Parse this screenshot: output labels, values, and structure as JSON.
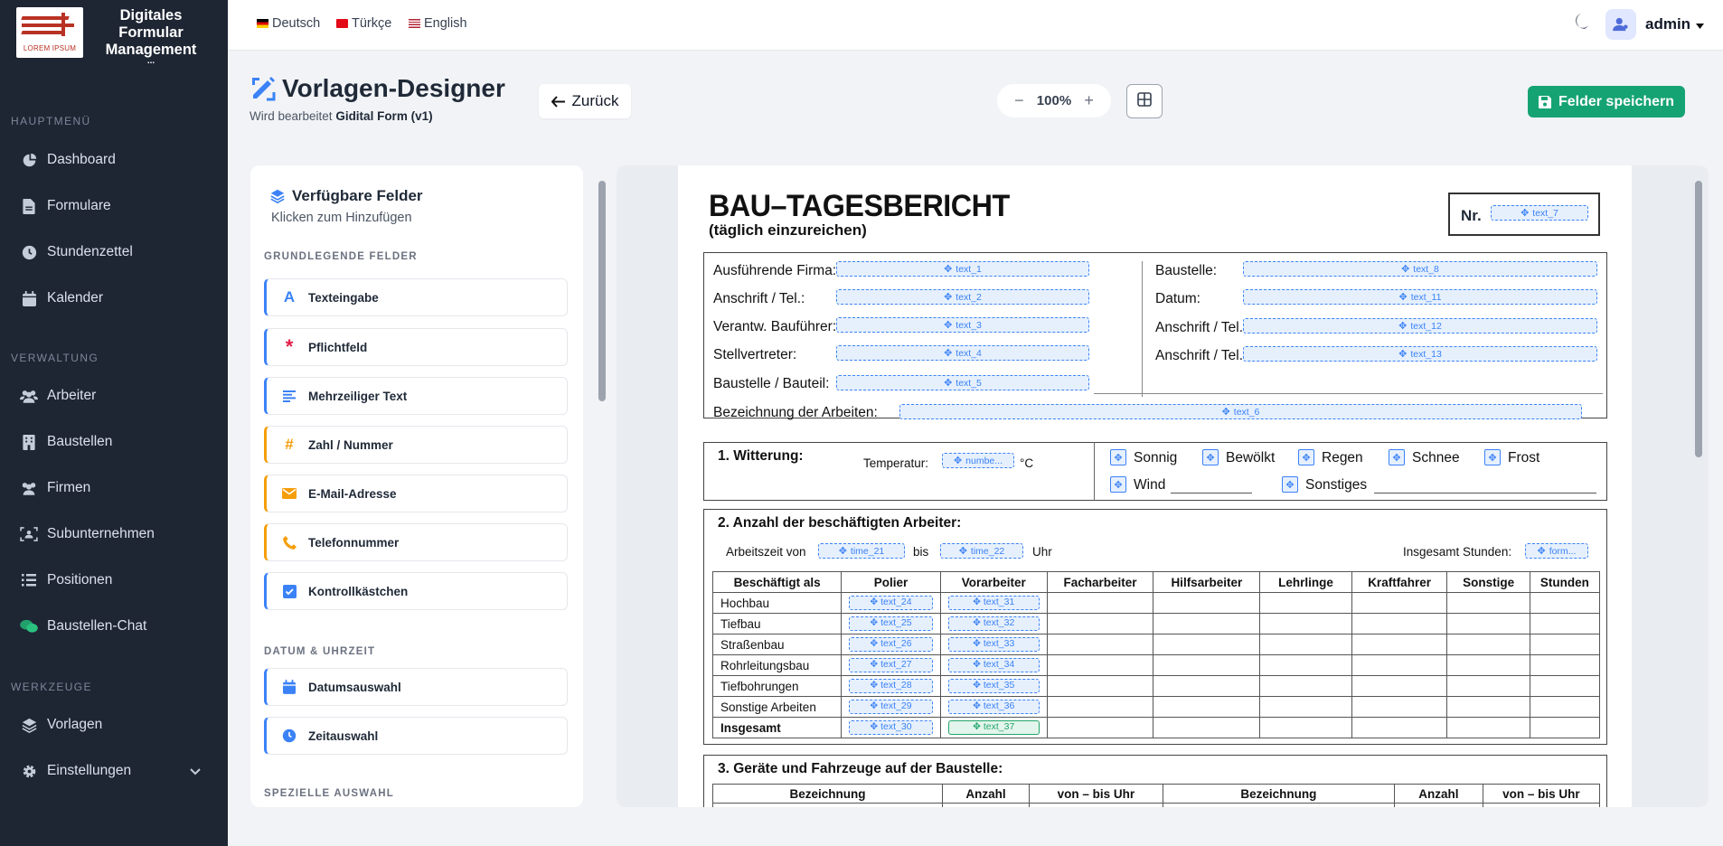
{
  "brand": {
    "name_lines": [
      "Digitales",
      "Formular",
      "Management"
    ],
    "name_ellipsis": "...",
    "logo_text": "LOREM IPSUM"
  },
  "sidebar": {
    "sections": [
      {
        "label": "HAUPTMENÜ",
        "items": [
          {
            "label": "Dashboard",
            "icon": "dashboard-icon"
          },
          {
            "label": "Formulare",
            "icon": "file-icon"
          },
          {
            "label": "Stundenzettel",
            "icon": "clock-icon"
          },
          {
            "label": "Kalender",
            "icon": "calendar-icon"
          }
        ]
      },
      {
        "label": "VERWALTUNG",
        "items": [
          {
            "label": "Arbeiter",
            "icon": "users-icon"
          },
          {
            "label": "Baustellen",
            "icon": "building-icon"
          },
          {
            "label": "Firmen",
            "icon": "users-icon"
          },
          {
            "label": "Subunternehmen",
            "icon": "user-group-icon"
          },
          {
            "label": "Positionen",
            "icon": "list-icon"
          },
          {
            "label": "Baustellen-Chat",
            "icon": "chat-icon"
          }
        ]
      },
      {
        "label": "WERKZEUGE",
        "items": [
          {
            "label": "Vorlagen",
            "icon": "layers-icon"
          },
          {
            "label": "Einstellungen",
            "icon": "gear-icon"
          }
        ]
      }
    ]
  },
  "topbar": {
    "languages": [
      {
        "label": "Deutsch",
        "flag": "de"
      },
      {
        "label": "Türkçe",
        "flag": "tr"
      },
      {
        "label": "English",
        "flag": "en"
      }
    ],
    "user": "admin"
  },
  "header": {
    "title": "Vorlagen-Designer",
    "subtitle_prefix": "Wird bearbeitet",
    "subtitle_form": "Gidital Form (v1)",
    "back_label": "Zurück",
    "zoom_label": "100%",
    "save_label": "Felder speichern"
  },
  "palette": {
    "title": "Verfügbare Felder",
    "subtitle": "Klicken zum Hinzufügen",
    "groups": [
      {
        "label": "GRUNDLEGENDE FELDER",
        "fields": [
          {
            "label": "Texteingabe",
            "icon": "text-icon"
          },
          {
            "label": "Pflichtfeld",
            "icon": "asterisk-icon"
          },
          {
            "label": "Mehrzeiliger Text",
            "icon": "paragraph-icon"
          },
          {
            "label": "Zahl / Nummer",
            "icon": "hash-icon"
          },
          {
            "label": "E-Mail-Adresse",
            "icon": "envelope-icon"
          },
          {
            "label": "Telefonnummer",
            "icon": "phone-icon"
          },
          {
            "label": "Kontrollkästchen",
            "icon": "checkbox-icon"
          }
        ]
      },
      {
        "label": "DATUM & UHRZEIT",
        "fields": [
          {
            "label": "Datumsauswahl",
            "icon": "calendar-icon"
          },
          {
            "label": "Zeitauswahl",
            "icon": "clock-icon"
          }
        ]
      },
      {
        "label": "SPEZIELLE AUSWAHL",
        "fields": []
      }
    ]
  },
  "doc": {
    "title": "BAU–TAGESBERICHT",
    "subtitle": "(täglich einzureichen)",
    "nr_label": "Nr.",
    "nr_field": "text_7",
    "left_rows": [
      {
        "label": "Ausführende Firma:",
        "field": "text_1"
      },
      {
        "label": "Anschrift / Tel.:",
        "field": "text_2"
      },
      {
        "label": "Verantw. Bauführer:",
        "field": "text_3"
      },
      {
        "label": "Stellvertreter:",
        "field": "text_4"
      },
      {
        "label": "Baustelle / Bauteil:",
        "field": "text_5"
      }
    ],
    "right_rows": [
      {
        "label": "Baustelle:",
        "field": "text_8"
      },
      {
        "label": "Datum:",
        "field": "text_11"
      },
      {
        "label": "Anschrift / Tel.:",
        "field": "text_12"
      },
      {
        "label": "Anschrift / Tel.:",
        "field": "text_13"
      }
    ],
    "work_label": "Bezeichnung der Arbeiten:",
    "work_field": "text_6",
    "weather": {
      "title": "1. Witterung:",
      "temp_label": "Temperatur:",
      "temp_field": "numbe...",
      "temp_unit": "°C",
      "options": [
        "Sonnig",
        "Bewölkt",
        "Regen",
        "Schnee",
        "Frost",
        "Wind",
        "Sonstiges"
      ]
    },
    "workers": {
      "title": "2. Anzahl der beschäftigten Arbeiter:",
      "time_label": "Arbeitszeit von",
      "time_from": "time_21",
      "time_to_label": "bis",
      "time_to": "time_22",
      "time_unit": "Uhr",
      "total_label": "Insgesamt Stunden:",
      "total_field": "form...",
      "columns": [
        "Beschäftigt als",
        "Polier",
        "Vorarbeiter",
        "Facharbeiter",
        "Hilfsarbeiter",
        "Lehrlinge",
        "Kraftfahrer",
        "Sonstige",
        "Stunden"
      ],
      "rows": [
        {
          "label": "Hochbau",
          "polier": "text_24",
          "vorarbeiter": "text_31"
        },
        {
          "label": "Tiefbau",
          "polier": "text_25",
          "vorarbeiter": "text_32"
        },
        {
          "label": "Straßenbau",
          "polier": "text_26",
          "vorarbeiter": "text_33"
        },
        {
          "label": "Rohrleitungsbau",
          "polier": "text_27",
          "vorarbeiter": "text_34"
        },
        {
          "label": "Tiefbohrungen",
          "polier": "text_28",
          "vorarbeiter": "text_35"
        },
        {
          "label": "Sonstige Arbeiten",
          "polier": "text_29",
          "vorarbeiter": "text_36"
        },
        {
          "label": "Insgesamt",
          "polier": "text_30",
          "vorarbeiter": "text_37",
          "bold": true,
          "selected": true
        }
      ]
    },
    "equipment": {
      "title": "3. Geräte und Fahrzeuge auf der Baustelle:",
      "columns": [
        "Bezeichnung",
        "Anzahl",
        "von – bis Uhr",
        "Bezeichnung",
        "Anzahl",
        "von – bis Uhr"
      ]
    }
  },
  "colors": {
    "sidebar_bg": "#1e2533",
    "accent": "#3b82f6",
    "save_green": "#16a373",
    "selected_field": "#22a56b"
  }
}
